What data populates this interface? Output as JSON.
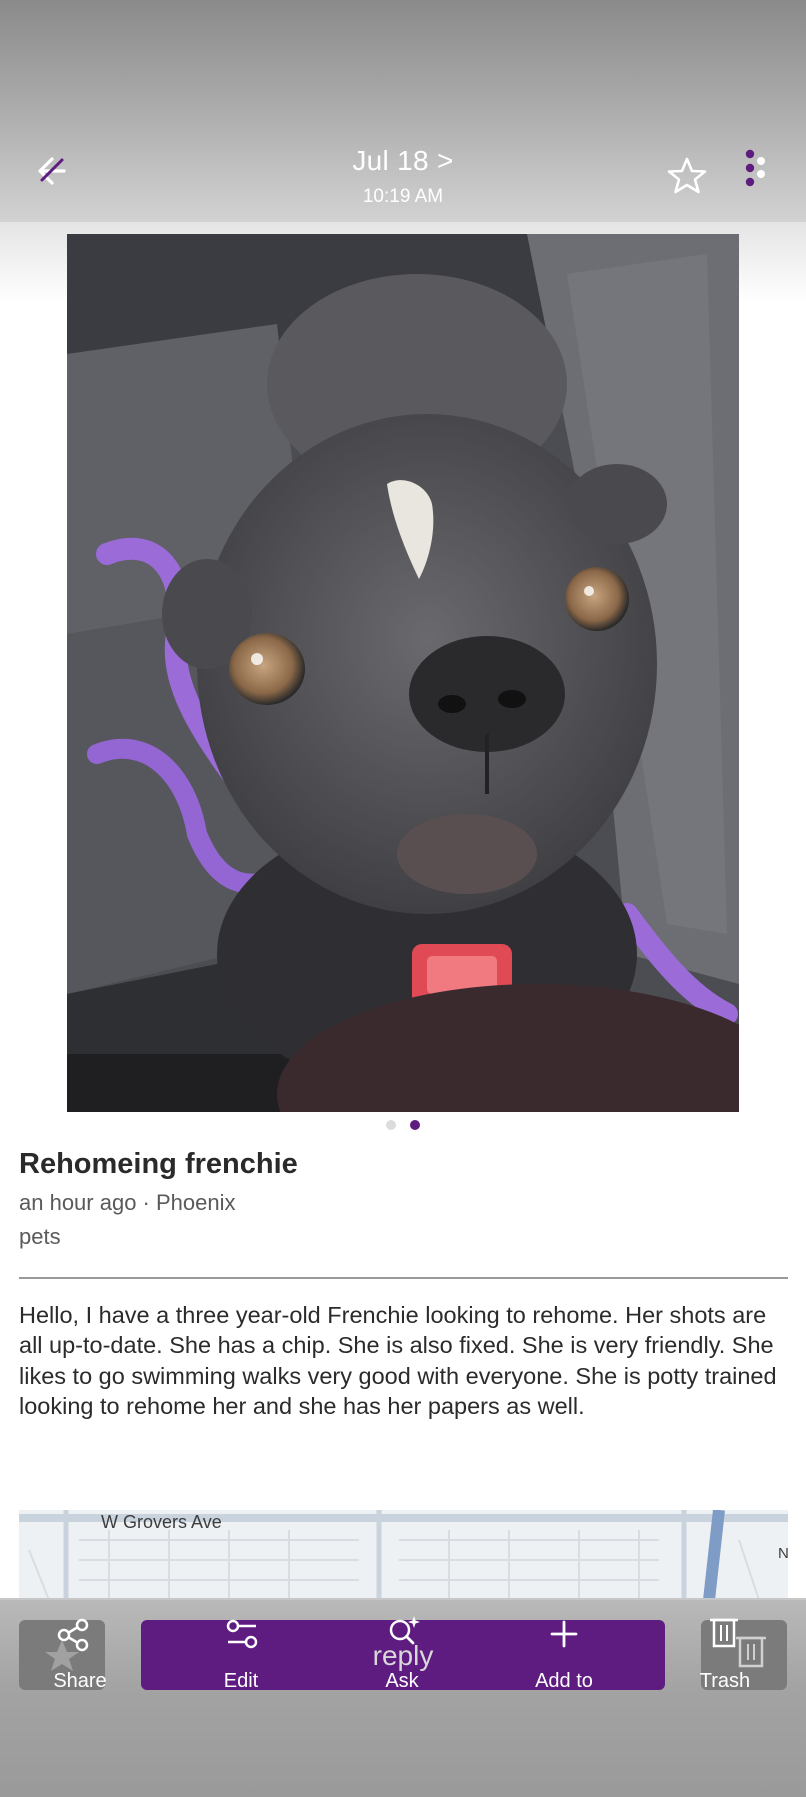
{
  "header": {
    "date": "Jul 18 >",
    "time": "10:19 AM",
    "back_icon": "back-arrow-icon",
    "star_icon": "star-outline-icon",
    "more_icon": "more-vert-icon"
  },
  "carousel": {
    "total": 2,
    "active": 2
  },
  "post": {
    "title": "Rehomeing frenchie",
    "meta": "an hour ago · Phoenix",
    "category": "pets",
    "description": "Hello, I have a three year-old Frenchie looking to rehome. Her shots are all up-to-date. She has a chip. She is also fixed. She is very friendly. She likes to go swimming walks very good with everyone. She is potty trained looking to rehome her and she has her papers as well."
  },
  "map": {
    "street": "W Grovers Ave",
    "edge_letter": "N"
  },
  "actions": {
    "share": "Share",
    "edit": "Edit",
    "reply": "reply",
    "ask": "Ask",
    "add_to": "Add to",
    "trash": "Trash"
  },
  "colors": {
    "accent": "#5e1b80",
    "gray_button": "#7b7b7b",
    "harness": "#9b6bd8"
  }
}
